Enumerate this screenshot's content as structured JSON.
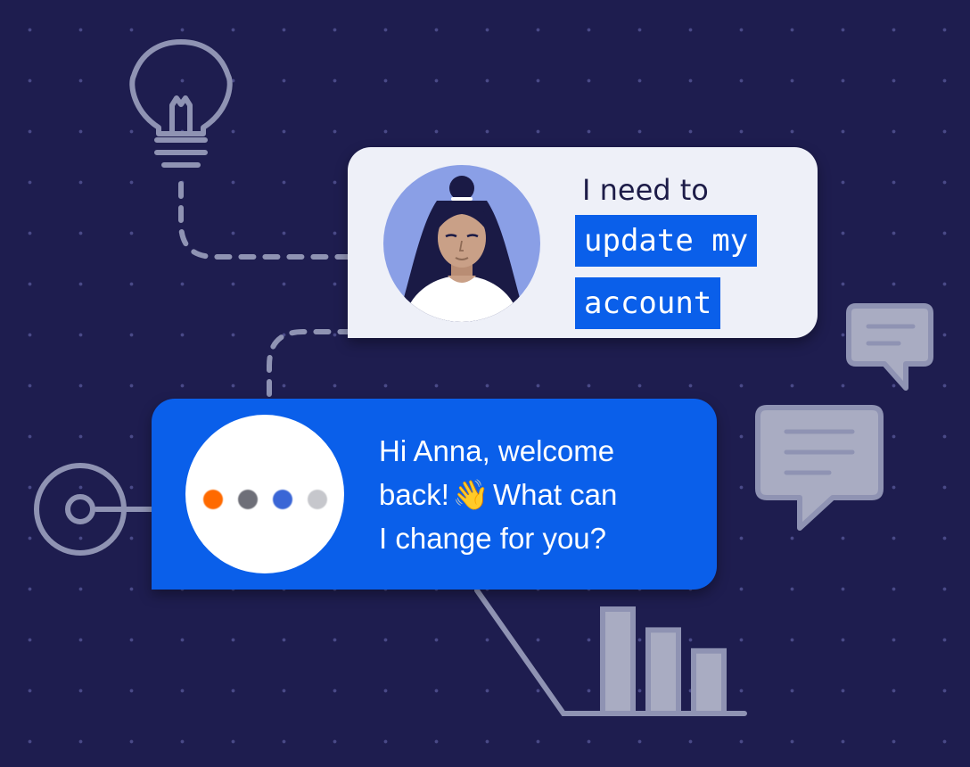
{
  "background": {
    "color": "#1e1d4f",
    "dot_color": "#4a4a88"
  },
  "colors": {
    "accent": "#0a5fea",
    "icon_stroke": "#8f93b3",
    "icon_fill": "#a9acc2"
  },
  "user_message": {
    "line1": "I need to",
    "highlight_line1": "update my",
    "highlight_line2": "account"
  },
  "bot_message": {
    "line1": "Hi Anna, welcome",
    "line2_start": "back!",
    "emoji": "👋",
    "line2_end": "What can",
    "line3": "I change for you?"
  },
  "typing_indicator": {
    "dot_colors": [
      "#ff6a00",
      "#6e6f78",
      "#3a66d6",
      "#c6c7cc"
    ]
  },
  "icons": [
    "lightbulb-icon",
    "target-icon",
    "chat-bubble-icon",
    "chat-bubble-icon",
    "bar-chart-icon"
  ],
  "bar_chart": {
    "values": [
      3,
      2.4,
      1.8
    ]
  }
}
